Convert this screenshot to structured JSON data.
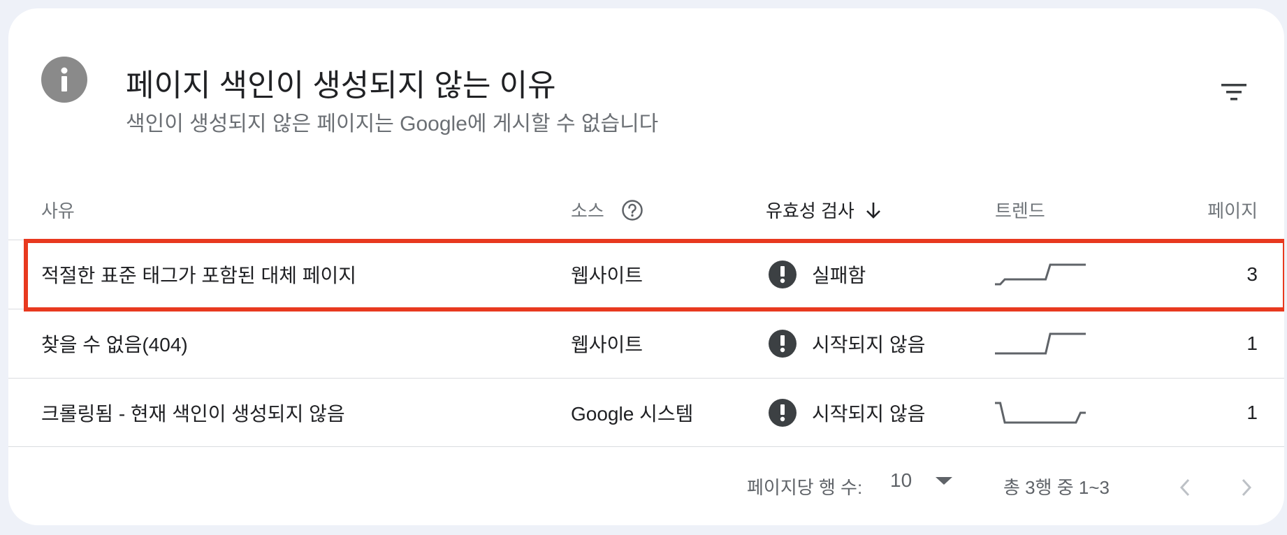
{
  "header": {
    "title": "페이지 색인이 생성되지 않는 이유",
    "subtitle": "색인이 생성되지 않은 페이지는 Google에 게시할 수 없습니다"
  },
  "columns": {
    "reason": "사유",
    "source": "소스",
    "validation": "유효성 검사",
    "trend": "트렌드",
    "pages": "페이지"
  },
  "rows": [
    {
      "reason": "적절한 표준 태그가 포함된 대체 페이지",
      "source": "웹사이트",
      "status": "실패함",
      "pages": "3",
      "trend": [
        0,
        0.25,
        0.25,
        0.25,
        1,
        1,
        1
      ]
    },
    {
      "reason": "찾을 수 없음(404)",
      "source": "웹사이트",
      "status": "시작되지 않음",
      "pages": "1",
      "trend": [
        0,
        0,
        0,
        0,
        1,
        1,
        1
      ]
    },
    {
      "reason": "크롤링됨 - 현재 색인이 생성되지 않음",
      "source": "Google 시스템",
      "status": "시작되지 않음",
      "pages": "1",
      "trend": [
        1,
        0,
        0,
        0,
        0,
        0,
        0.5
      ]
    }
  ],
  "footer": {
    "rows_per_page_label": "페이지당 행 수:",
    "rows_per_page_value": "10",
    "range": "총 3행 중 1~3"
  },
  "colors": {
    "highlight": "#e8391f",
    "card": "#ffffff",
    "background": "#eef1f8"
  }
}
